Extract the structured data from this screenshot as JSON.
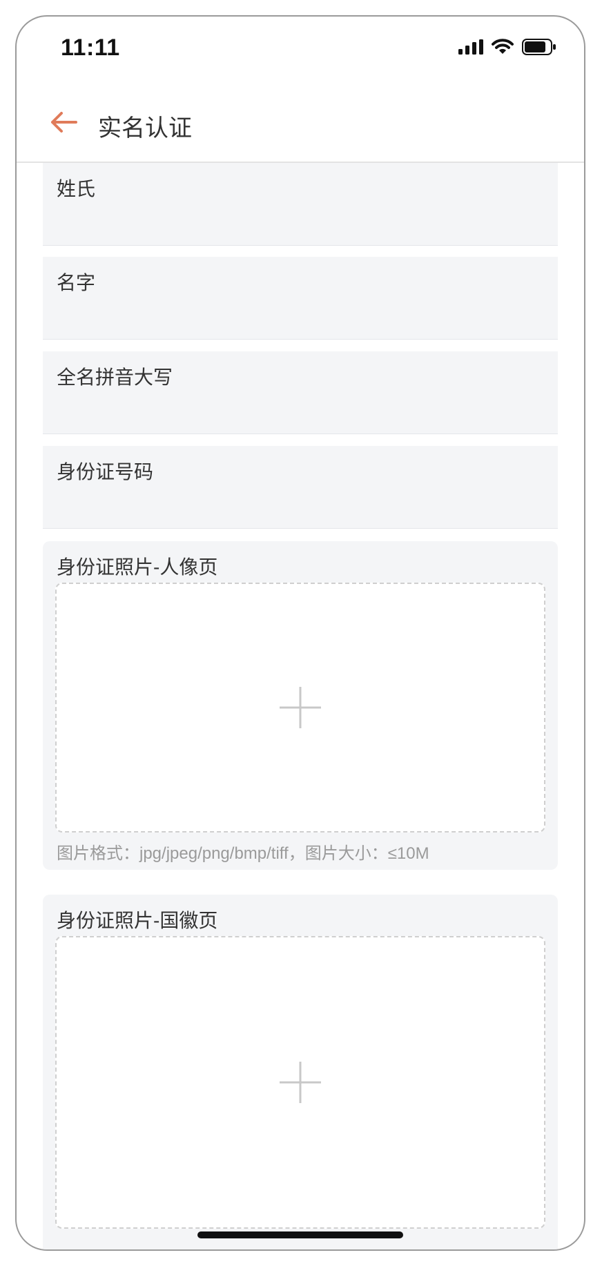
{
  "status_bar": {
    "time": "11:11"
  },
  "nav": {
    "title": "实名认证"
  },
  "form": {
    "fields": [
      {
        "label": "姓氏",
        "value": ""
      },
      {
        "label": "名字",
        "value": ""
      },
      {
        "label": "全名拼音大写",
        "value": ""
      },
      {
        "label": "身份证号码",
        "value": ""
      }
    ],
    "uploads": [
      {
        "label": "身份证照片-人像页",
        "hint": "图片格式：jpg/jpeg/png/bmp/tiff，图片大小：≤10M"
      },
      {
        "label": "身份证照片-国徽页"
      }
    ]
  },
  "colors": {
    "accent": "#e07b5a",
    "field_bg": "#f4f5f7",
    "text": "#333333",
    "hint": "#9a9a9a"
  },
  "icons": [
    "signal-icon",
    "wifi-icon",
    "battery-icon",
    "back-arrow-icon",
    "plus-icon"
  ]
}
